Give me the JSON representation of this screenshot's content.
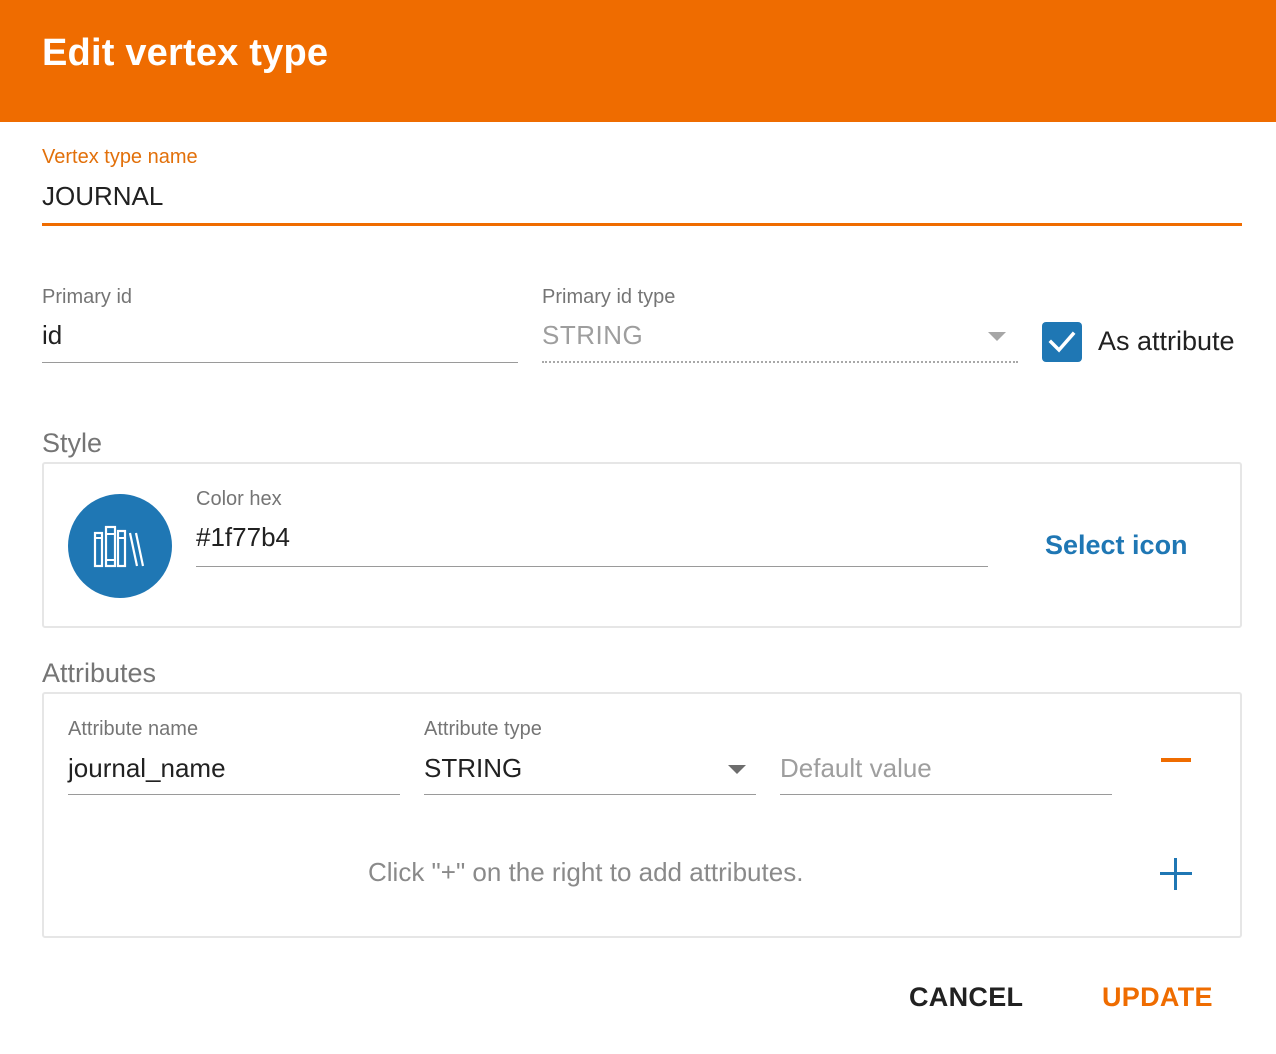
{
  "dialog": {
    "title": "Edit vertex type"
  },
  "vertex_name": {
    "label": "Vertex type name",
    "value": "JOURNAL"
  },
  "primary_id": {
    "label": "Primary id",
    "value": "id"
  },
  "primary_id_type": {
    "label": "Primary id type",
    "value": "STRING"
  },
  "as_attribute": {
    "label": "As attribute",
    "checked": true
  },
  "style": {
    "section_title": "Style",
    "color_label": "Color hex",
    "color_value": "#1f77b4",
    "icon": "books-icon",
    "select_icon_label": "Select icon"
  },
  "attributes": {
    "section_title": "Attributes",
    "rows": [
      {
        "name_label": "Attribute name",
        "name_value": "journal_name",
        "type_label": "Attribute type",
        "type_value": "STRING",
        "default_placeholder": "Default value"
      }
    ],
    "hint": "Click \"+\" on the right to add attributes."
  },
  "actions": {
    "cancel_label": "CANCEL",
    "update_label": "UPDATE"
  },
  "colors": {
    "accent": "#ef6c00",
    "primary": "#1f77b4"
  }
}
